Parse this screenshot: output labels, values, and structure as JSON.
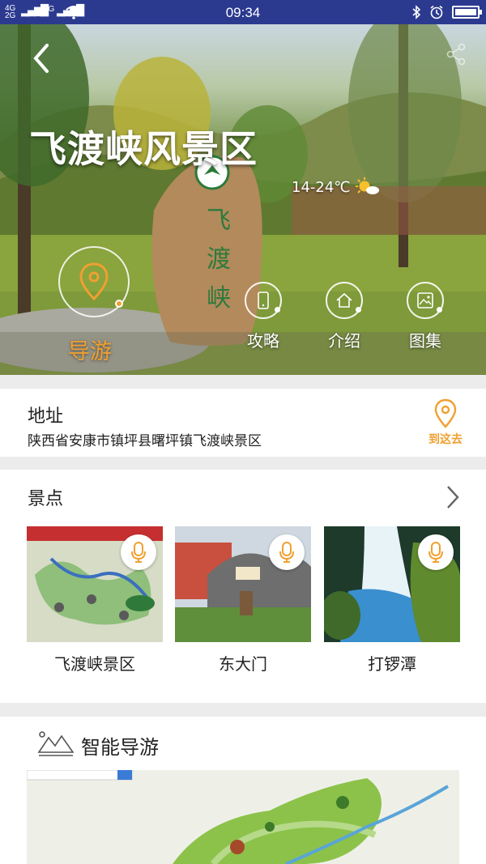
{
  "status_bar": {
    "signal_1": "4G",
    "signal_2": "2G",
    "signal_3": "2G",
    "time": "09:34"
  },
  "hero": {
    "title": "飞渡峡风景区",
    "stone_text": "飞渡峡",
    "weather": "14-24℃",
    "guide_label": "导游",
    "nav": [
      {
        "label": "攻略",
        "icon": "phone-icon"
      },
      {
        "label": "介绍",
        "icon": "home-icon"
      },
      {
        "label": "图集",
        "icon": "picture-icon"
      }
    ]
  },
  "address": {
    "title": "地址",
    "text": "陕西省安康市镇坪县曙坪镇飞渡峡景区",
    "goto_label": "到这去"
  },
  "spots": {
    "title": "景点",
    "items": [
      {
        "name": "飞渡峡景区"
      },
      {
        "name": "东大门"
      },
      {
        "name": "打锣潭"
      }
    ]
  },
  "smart_guide": {
    "title": "智能导游"
  },
  "colors": {
    "accent": "#f0a030",
    "status_bar": "#2b3a8f"
  }
}
